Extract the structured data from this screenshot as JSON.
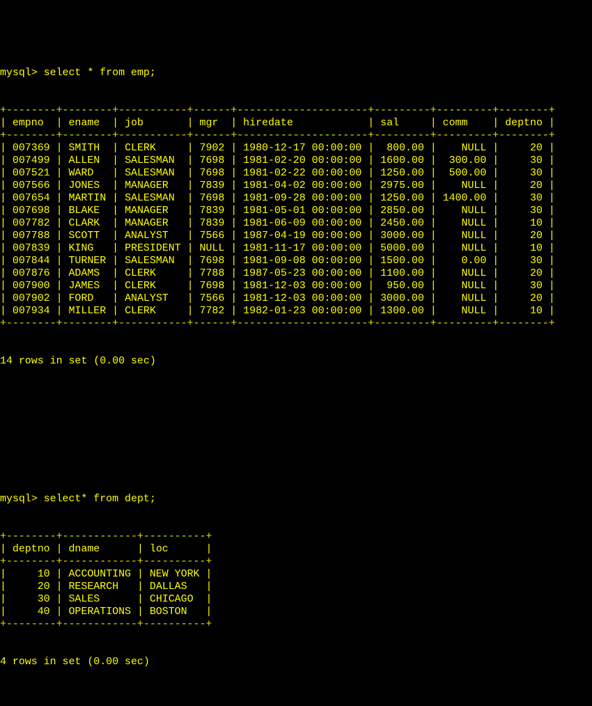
{
  "window": {
    "app": "mysql client terminal",
    "text_color": "#ffff00",
    "background_color": "#000000"
  },
  "blocks": [
    {
      "prompt": "mysql>",
      "command": "select * from emp;",
      "table": {
        "columns": [
          {
            "name": "empno",
            "align": "left"
          },
          {
            "name": "ename",
            "align": "left"
          },
          {
            "name": "job",
            "align": "left"
          },
          {
            "name": "mgr",
            "align": "left"
          },
          {
            "name": "hiredate",
            "align": "left"
          },
          {
            "name": "sal",
            "align": "right"
          },
          {
            "name": "comm",
            "align": "right"
          },
          {
            "name": "deptno",
            "align": "right"
          }
        ],
        "widths": [
          6,
          6,
          9,
          4,
          19,
          7,
          7,
          6
        ],
        "rows": [
          [
            "007369",
            "SMITH",
            "CLERK",
            "7902",
            "1980-12-17 00:00:00",
            "800.00",
            "NULL",
            "20"
          ],
          [
            "007499",
            "ALLEN",
            "SALESMAN",
            "7698",
            "1981-02-20 00:00:00",
            "1600.00",
            "300.00",
            "30"
          ],
          [
            "007521",
            "WARD",
            "SALESMAN",
            "7698",
            "1981-02-22 00:00:00",
            "1250.00",
            "500.00",
            "30"
          ],
          [
            "007566",
            "JONES",
            "MANAGER",
            "7839",
            "1981-04-02 00:00:00",
            "2975.00",
            "NULL",
            "20"
          ],
          [
            "007654",
            "MARTIN",
            "SALESMAN",
            "7698",
            "1981-09-28 00:00:00",
            "1250.00",
            "1400.00",
            "30"
          ],
          [
            "007698",
            "BLAKE",
            "MANAGER",
            "7839",
            "1981-05-01 00:00:00",
            "2850.00",
            "NULL",
            "30"
          ],
          [
            "007782",
            "CLARK",
            "MANAGER",
            "7839",
            "1981-06-09 00:00:00",
            "2450.00",
            "NULL",
            "10"
          ],
          [
            "007788",
            "SCOTT",
            "ANALYST",
            "7566",
            "1987-04-19 00:00:00",
            "3000.00",
            "NULL",
            "20"
          ],
          [
            "007839",
            "KING",
            "PRESIDENT",
            "NULL",
            "1981-11-17 00:00:00",
            "5000.00",
            "NULL",
            "10"
          ],
          [
            "007844",
            "TURNER",
            "SALESMAN",
            "7698",
            "1981-09-08 00:00:00",
            "1500.00",
            "0.00",
            "30"
          ],
          [
            "007876",
            "ADAMS",
            "CLERK",
            "7788",
            "1987-05-23 00:00:00",
            "1100.00",
            "NULL",
            "20"
          ],
          [
            "007900",
            "JAMES",
            "CLERK",
            "7698",
            "1981-12-03 00:00:00",
            "950.00",
            "NULL",
            "30"
          ],
          [
            "007902",
            "FORD",
            "ANALYST",
            "7566",
            "1981-12-03 00:00:00",
            "3000.00",
            "NULL",
            "20"
          ],
          [
            "007934",
            "MILLER",
            "CLERK",
            "7782",
            "1982-01-23 00:00:00",
            "1300.00",
            "NULL",
            "10"
          ]
        ]
      },
      "summary": "14 rows in set (0.00 sec)"
    },
    {
      "prompt": "mysql>",
      "command": "select* from dept;",
      "table": {
        "columns": [
          {
            "name": "deptno",
            "align": "right"
          },
          {
            "name": "dname",
            "align": "left"
          },
          {
            "name": "loc",
            "align": "left"
          }
        ],
        "widths": [
          6,
          10,
          8
        ],
        "rows": [
          [
            "10",
            "ACCOUNTING",
            "NEW YORK"
          ],
          [
            "20",
            "RESEARCH",
            "DALLAS"
          ],
          [
            "30",
            "SALES",
            "CHICAGO"
          ],
          [
            "40",
            "OPERATIONS",
            "BOSTON"
          ]
        ]
      },
      "summary": "4 rows in set (0.00 sec)"
    }
  ]
}
